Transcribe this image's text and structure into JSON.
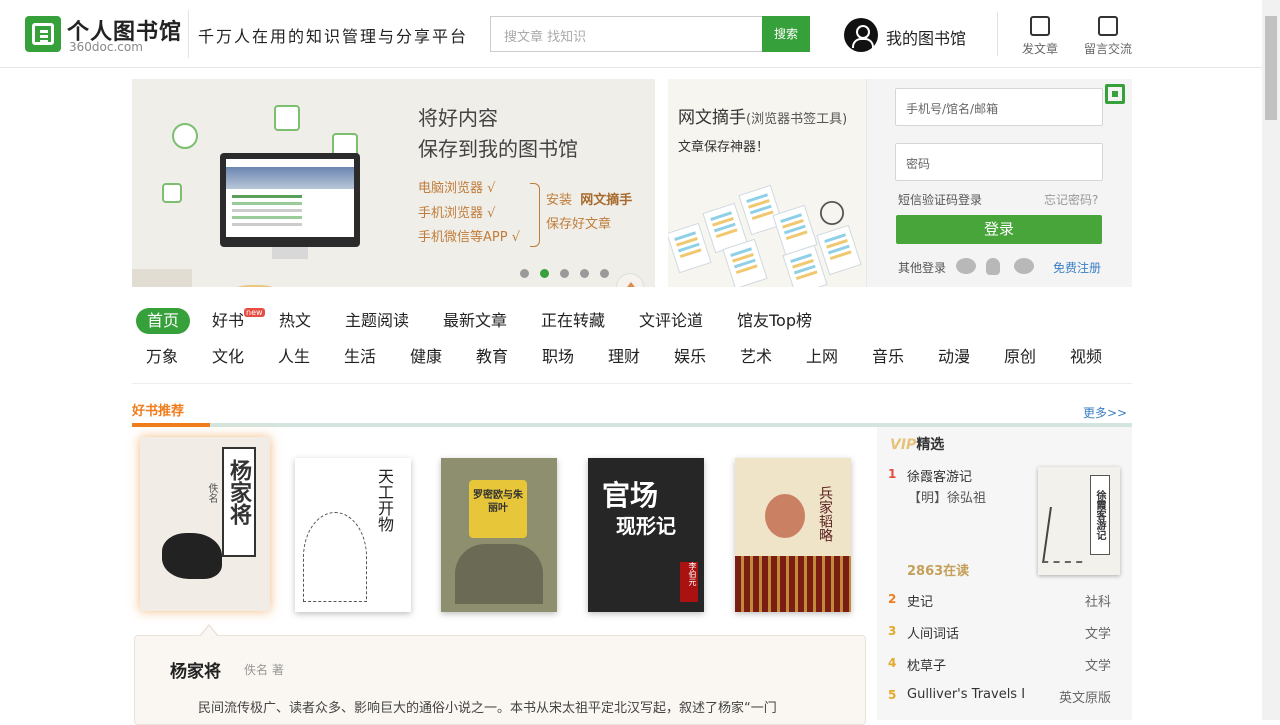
{
  "header": {
    "logo_name": "个人图书馆",
    "logo_sub": "360doc.com",
    "slogan": "千万人在用的知识管理与分享平台",
    "search_placeholder": "搜文章  找知识",
    "search_button": "搜索",
    "my_library": "我的图书馆",
    "post_article": "发文章",
    "message": "留言交流",
    "brand_color": "#36a03a"
  },
  "banner": {
    "headline_1": "将好内容",
    "headline_2": "保存到我的图书馆",
    "list": [
      "电脑浏览器 √",
      "手机浏览器 √",
      "手机微信等APP √"
    ],
    "install_label": "安装",
    "install_name": "网文摘手",
    "save_label": "保存好文章",
    "slide_count": 5,
    "active_slide": 2
  },
  "netpick": {
    "title": "网文摘手",
    "title_note": "(浏览器书签工具)",
    "subtitle": "文章保存神器！"
  },
  "login": {
    "user_placeholder": "手机号/馆名/邮箱",
    "pass_placeholder": "密码",
    "sms_login": "短信验证码登录",
    "forgot": "忘记密码?",
    "login_button": "登录",
    "other_login": "其他登录",
    "register": "免费注册"
  },
  "nav": {
    "primary": [
      "首页",
      "好书",
      "热文",
      "主题阅读",
      "最新文章",
      "正在转藏",
      "文评论道",
      "馆友Top榜"
    ],
    "new_badge": "new",
    "secondary": [
      "万象",
      "文化",
      "人生",
      "生活",
      "健康",
      "教育",
      "职场",
      "理财",
      "娱乐",
      "艺术",
      "上网",
      "音乐",
      "动漫",
      "原创",
      "视频"
    ]
  },
  "recommend": {
    "title": "好书推荐",
    "more": "更多>>",
    "accent_color": "#f07c1c",
    "covers": {
      "b1_title": "杨家将",
      "b1_author": "佚名",
      "b2_title": "天工开物",
      "b3_title": "罗密欧与朱丽叶",
      "b4_title_1": "官场",
      "b4_title_2": "现形记",
      "b4_author": "李伯元",
      "b5_title": "兵家韬略"
    },
    "detail": {
      "title": "杨家将",
      "author": "佚名 著",
      "desc": "民间流传极广、读者众多、影响巨大的通俗小说之一。本书从宋太祖平定北汉写起，叙述了杨家“一门"
    }
  },
  "vip": {
    "prefix": "VIP",
    "title": "精选",
    "top": {
      "rank": "1",
      "name": "徐霞客游记",
      "author": "【明】徐弘祖",
      "reads": "2863在读",
      "cover_title": "徐霞客游记"
    },
    "items": [
      {
        "rank": "2",
        "name": "史记",
        "category": "社科"
      },
      {
        "rank": "3",
        "name": "人间词话",
        "category": "文学"
      },
      {
        "rank": "4",
        "name": "枕草子",
        "category": "文学"
      },
      {
        "rank": "5",
        "name": "Gulliver's Travels I",
        "category": "英文原版"
      }
    ]
  }
}
